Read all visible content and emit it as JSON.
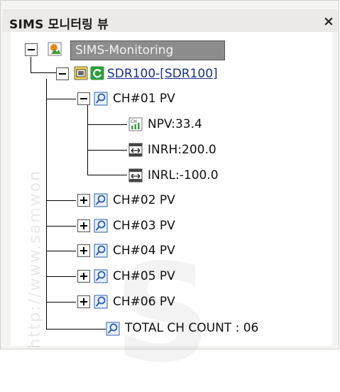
{
  "window": {
    "title": "SIMS 모니터링 뷰",
    "close_label": "×"
  },
  "watermark": {
    "text": "http://www.samwon",
    "logo_text": "S"
  },
  "tree": {
    "root": {
      "label": "SIMS-Monitoring",
      "expander": "minus"
    },
    "device": {
      "label": "SDR100-[SDR100]",
      "expander": "minus"
    },
    "channels": [
      {
        "label": "CH#01 PV",
        "expander": "minus"
      },
      {
        "label": "CH#02 PV",
        "expander": "plus"
      },
      {
        "label": "CH#03 PV",
        "expander": "plus"
      },
      {
        "label": "CH#04 PV",
        "expander": "plus"
      },
      {
        "label": "CH#05 PV",
        "expander": "plus"
      },
      {
        "label": "CH#06 PV",
        "expander": "plus"
      }
    ],
    "ch1_children": [
      {
        "label": "NPV:33.4",
        "icon": "chart-icon"
      },
      {
        "label": "INRH:200.0",
        "icon": "range-icon"
      },
      {
        "label": "INRL:-100.0",
        "icon": "range-icon"
      }
    ],
    "total": {
      "label": "TOTAL CH COUNT : 06"
    }
  },
  "colors": {
    "selection_bg": "#8d8d8d",
    "link_text": "#1a2f8a",
    "icon_blue": "#2a5db0",
    "icon_green": "#2e9b3c"
  }
}
